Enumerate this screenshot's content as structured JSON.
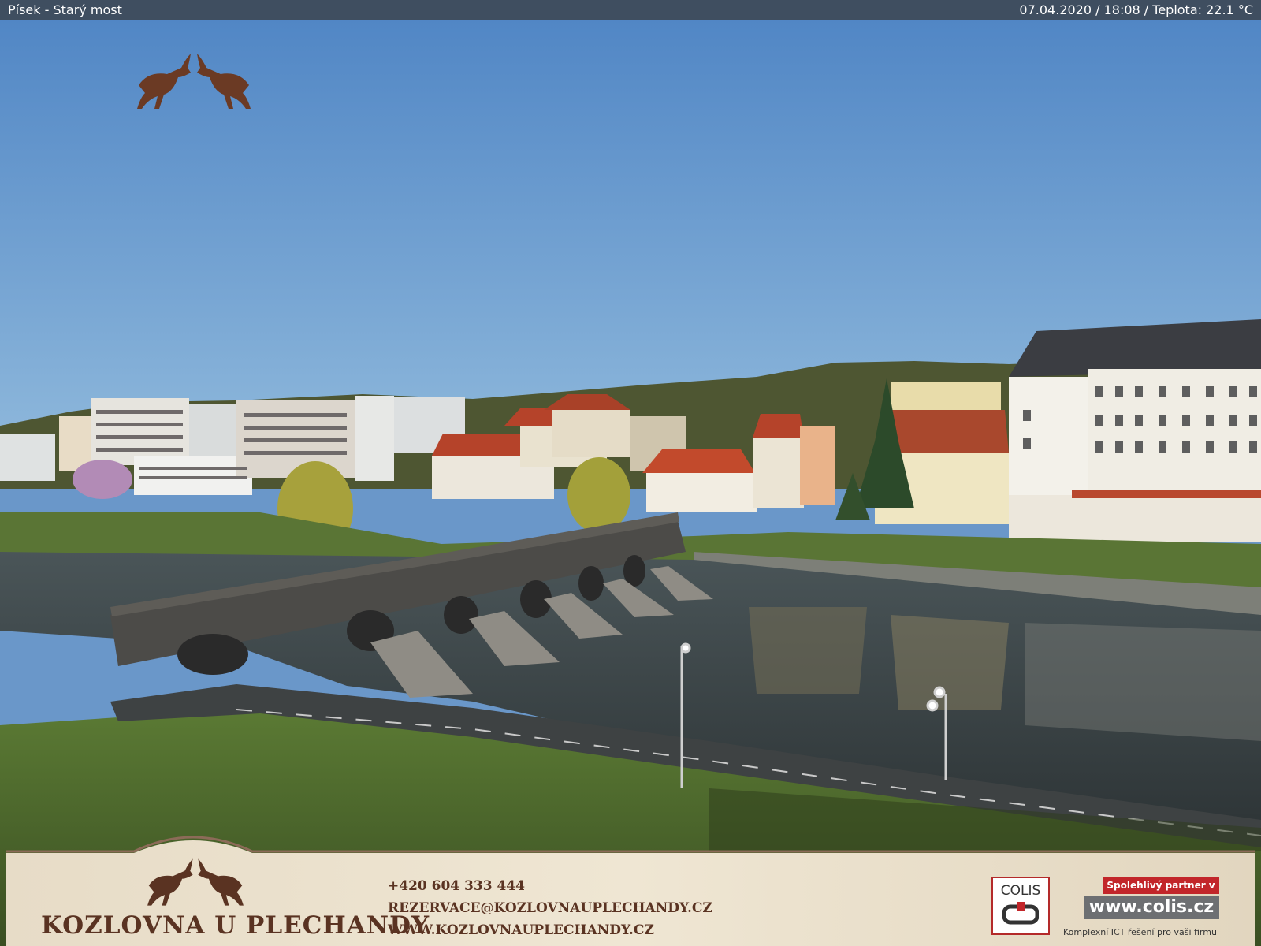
{
  "topbar": {
    "title": "Písek - Starý most",
    "info": "07.04.2020 / 18:08 / Teplota: 22.1 °C"
  },
  "ad": {
    "brand": "KOZLOVNA U PLECHANDY",
    "phone": "+420 604 333 444",
    "email": "REZERVACE@KOZLOVNAUPLECHANDY.CZ",
    "web": "WWW.KOZLOVNAUPLECHANDY.CZ"
  },
  "sponsor": {
    "logo_text": "COLIS",
    "badge": "Spolehlivý partner v IT",
    "url": "www.colis.cz",
    "tagline": "Komplexní ICT řešení pro vaši firmu"
  },
  "colors": {
    "sky_top": "#4e84c4",
    "sky_bottom": "#8db7db",
    "water": "#3d4548",
    "grass": "#4f6a2c",
    "roof": "#b5432a",
    "topbar": "#3f4e60",
    "brand_brown": "#5a3322",
    "colis_red": "#c2262a"
  },
  "icons": [
    "goats-logo-icon",
    "goats-ad-icon",
    "colis-logo-icon"
  ]
}
